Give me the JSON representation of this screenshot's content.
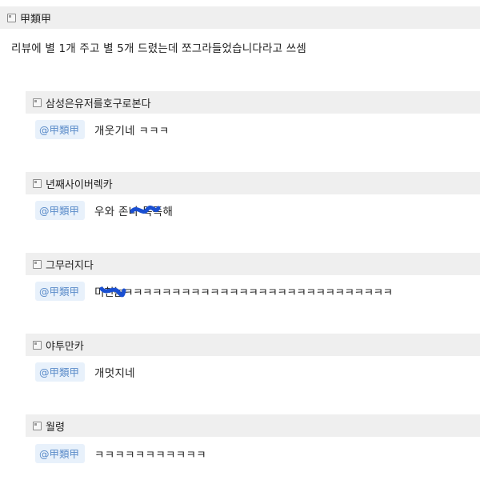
{
  "post": {
    "author": "甲類甲",
    "text": "리뷰에 별 1개 주고 별 5개 드렸는데 쪼그라들었습니다라고 쓰셈"
  },
  "comments": [
    {
      "author": "삼성은유저를호구로본다",
      "mention": "@甲類甲",
      "text": "개웃기네 ㅋㅋㅋ"
    },
    {
      "author": "년째사이버렉카",
      "mention": "@甲類甲",
      "text": "우와 존나 똑똑해"
    },
    {
      "author": "그무러지다",
      "mention": "@甲類甲",
      "text": "미친놈ㅋㅋㅋㅋㅋㅋㅋㅋㅋㅋㅋㅋㅋㅋㅋㅋㅋㅋㅋㅋㅋㅋㅋㅋㅋㅋㅋㅋ"
    },
    {
      "author": "야투만카",
      "mention": "@甲類甲",
      "text": "개멋지네"
    },
    {
      "author": "월령",
      "mention": "@甲類甲",
      "text": "ㅋㅋㅋㅋㅋㅋㅋㅋㅋㅋㅋ"
    }
  ],
  "colors": {
    "bar_bg": "#efefef",
    "mention_bg": "#e8f1fb",
    "mention_text": "#5a8bc9",
    "scribble": "#1a4fd1"
  },
  "icons": {
    "user_badge": "user-level-icon",
    "redaction": "blue-scribble"
  }
}
